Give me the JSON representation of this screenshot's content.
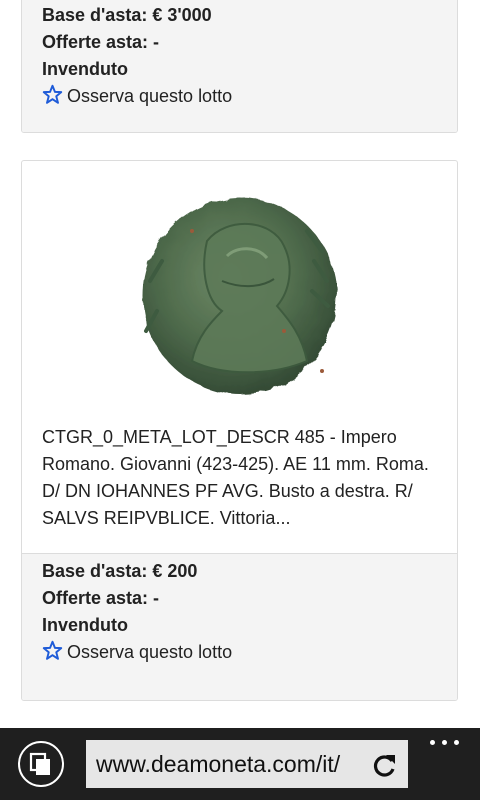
{
  "lots": [
    {
      "base_label": "Base d'asta: € 3'000",
      "offers_label": "Offerte asta: -",
      "status": "Invenduto",
      "watch_label": "Osserva questo lotto"
    },
    {
      "description": "CTGR_0_META_LOT_DESCR 485 - Impero Romano. Giovanni (423-425). AE 11 mm. Roma. D/ DN IOHANNES PF AVG. Busto a destra. R/ SALVS REIPVBLICE. Vittoria...",
      "base_label": "Base d'asta: € 200",
      "offers_label": "Offerte asta: -",
      "status": "Invenduto",
      "watch_label": "Osserva questo lotto"
    }
  ],
  "browser": {
    "url": "www.deamoneta.com/it/"
  },
  "colors": {
    "star": "#1e5bd8",
    "browser_bar": "#1f1f1f",
    "footer_bg": "#f4f4f4"
  },
  "icons": [
    "star-icon",
    "tabs-icon",
    "reload-icon",
    "more-icon"
  ]
}
